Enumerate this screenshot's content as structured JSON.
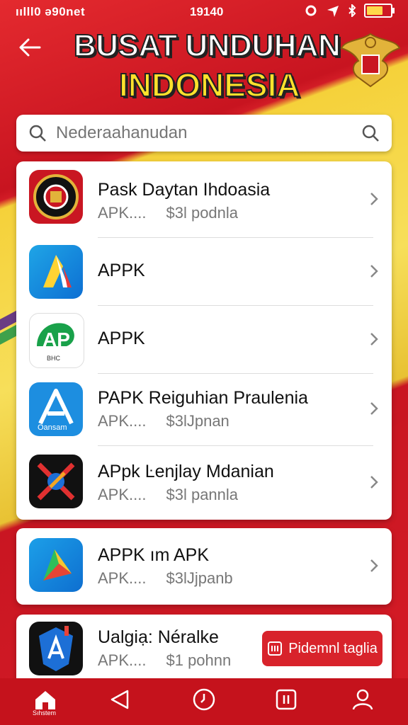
{
  "status_bar": {
    "carrier": "ıılll0 ə90net",
    "time": "19140"
  },
  "header": {
    "title_line1": "BUSAT UNDUHAN",
    "title_line2": "INDONESIA"
  },
  "search": {
    "placeholder": "Nederaahanudan"
  },
  "apps": [
    {
      "name": "Pask Daytan Ihdoasia",
      "type": "APK....",
      "size": "$3l podnla"
    },
    {
      "name": "APPK",
      "type": "",
      "size": ""
    },
    {
      "name": "APPK",
      "type": "",
      "size": "",
      "icon_text": "BHC"
    },
    {
      "name": "PAPK Reiguhian Praulenia",
      "type": "APK....",
      "size": "$3lJpnan",
      "icon_text": "Oansam"
    },
    {
      "name": "APpk Ŀenjlay Mdanian",
      "type": "APK....",
      "size": "$3l pannla"
    }
  ],
  "featured": {
    "name": "APPK ım APK",
    "type": "APK....",
    "size": "$3lJjpanb"
  },
  "partial": {
    "name": "Ualgiạ: Néralke",
    "type": "APK....",
    "size": "$1 pohnn",
    "button": "Pidemnl taglia"
  },
  "nav": {
    "home_label": "Sıhstem"
  },
  "colors": {
    "primary": "#d11a24",
    "accent": "#ffe22c"
  }
}
